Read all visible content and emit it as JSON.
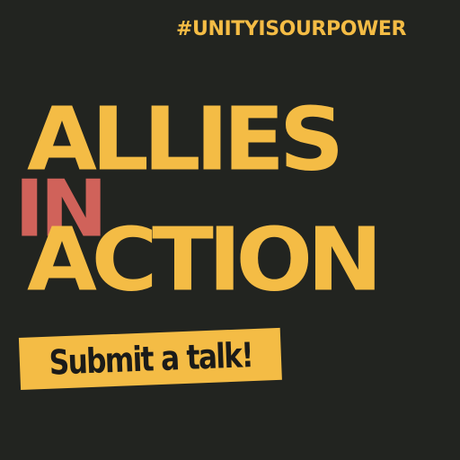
{
  "hashtag": "#UNITYISOURPOWER",
  "headline": {
    "line1": "ALLIES",
    "line2": "IN",
    "line3": "ACTION"
  },
  "cta": {
    "label": "Submit a talk!"
  },
  "colors": {
    "background": "#222420",
    "accent_yellow": "#F4BC45",
    "accent_red": "#D0625A",
    "dark_text": "#1B1B19"
  }
}
